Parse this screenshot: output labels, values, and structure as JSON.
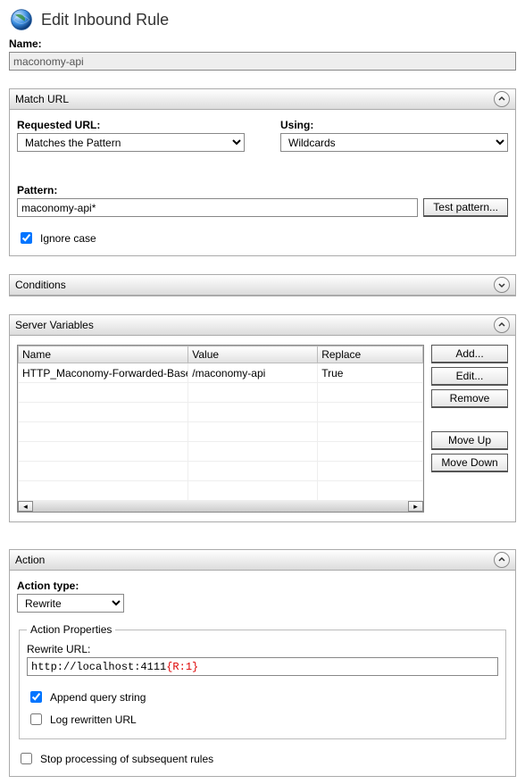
{
  "header": {
    "title": "Edit Inbound Rule"
  },
  "name": {
    "label": "Name:",
    "value": "maconomy-api"
  },
  "matchUrl": {
    "title": "Match URL",
    "requestedUrlLabel": "Requested URL:",
    "requestedUrlValue": "Matches the Pattern",
    "usingLabel": "Using:",
    "usingValue": "Wildcards",
    "patternLabel": "Pattern:",
    "patternValue": "maconomy-api*",
    "testPatternBtn": "Test pattern...",
    "ignoreCaseLabel": "Ignore case",
    "ignoreCaseChecked": true
  },
  "conditions": {
    "title": "Conditions"
  },
  "serverVars": {
    "title": "Server Variables",
    "columns": {
      "name": "Name",
      "value": "Value",
      "replace": "Replace"
    },
    "rows": [
      {
        "name": "HTTP_Maconomy-Forwarded-Base-Path",
        "value": "/maconomy-api",
        "replace": "True"
      }
    ],
    "buttons": {
      "add": "Add...",
      "edit": "Edit...",
      "remove": "Remove",
      "moveUp": "Move Up",
      "moveDown": "Move Down"
    }
  },
  "action": {
    "title": "Action",
    "typeLabel": "Action type:",
    "typeValue": "Rewrite",
    "propsTitle": "Action Properties",
    "rewriteUrlLabel": "Rewrite URL:",
    "rewriteUrlPrefix": "http://localhost:4111",
    "rewriteUrlToken": "{R:1}",
    "appendQueryLabel": "Append query string",
    "appendQueryChecked": true,
    "logRewrittenLabel": "Log rewritten URL",
    "logRewrittenChecked": false
  },
  "stopProcessing": {
    "label": "Stop processing of subsequent rules",
    "checked": false
  }
}
